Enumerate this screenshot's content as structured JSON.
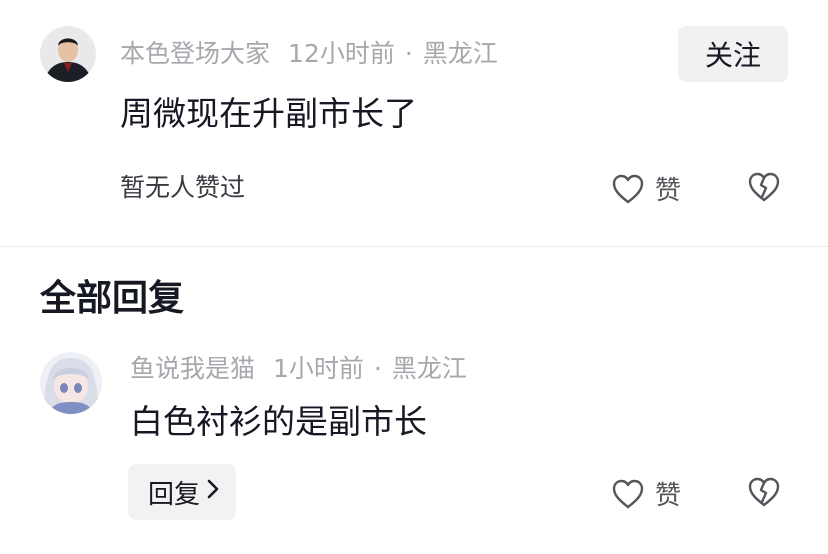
{
  "main_comment": {
    "username": "本色登场大家",
    "time": "12小时前",
    "separator": "·",
    "location": "黑龙江",
    "text": "周微现在升副市长了",
    "follow_label": "关注",
    "likers_text": "暂无人赞过",
    "like_label": "赞"
  },
  "replies_section": {
    "title": "全部回复"
  },
  "reply": {
    "username": "鱼说我是猫",
    "time": "1小时前",
    "separator": "·",
    "location": "黑龙江",
    "text": "白色衬衫的是副市长",
    "reply_label": "回复",
    "like_label": "赞"
  },
  "colors": {
    "meta_gray": "#a7a8ad",
    "text_dark": "#161823",
    "button_bg": "#f1f1f2"
  },
  "icons": {
    "like": "heart-outline-icon",
    "dislike": "broken-heart-icon",
    "chevron": "chevron-right-icon"
  }
}
